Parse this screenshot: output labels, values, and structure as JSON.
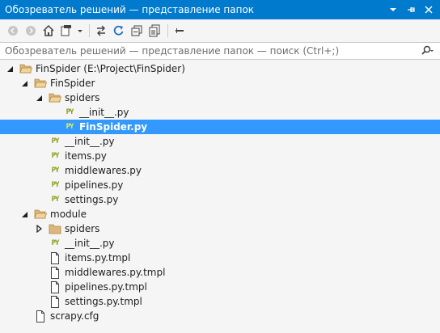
{
  "title": "Обозреватель решений — представление папок",
  "search": {
    "placeholder": "Обозреватель решений — представление папок — поиск (Ctrl+;)"
  },
  "colors": {
    "accent": "#007acc",
    "selection": "#3399ff",
    "python_badge": "#8a9a1b",
    "folder": "#dcb67a"
  },
  "tree": [
    {
      "label": "FinSpider (E:\\Project\\FinSpider)",
      "icon": "solution-folder-icon",
      "expander": "expanded"
    },
    {
      "label": "FinSpider",
      "icon": "folder-open-icon",
      "expander": "expanded"
    },
    {
      "label": "spiders",
      "icon": "folder-open-icon",
      "expander": "expanded"
    },
    {
      "label": "__init__.py",
      "icon": "python-file-icon",
      "badge": "PY",
      "expander": "none"
    },
    {
      "label": "FinSpider.py",
      "icon": "python-file-icon",
      "badge": "PY",
      "expander": "none",
      "selected": true
    },
    {
      "label": "__init__.py",
      "icon": "python-file-icon",
      "badge": "PY",
      "expander": "none"
    },
    {
      "label": "items.py",
      "icon": "python-file-icon",
      "badge": "PY",
      "expander": "none"
    },
    {
      "label": "middlewares.py",
      "icon": "python-file-icon",
      "badge": "PY",
      "expander": "none"
    },
    {
      "label": "pipelines.py",
      "icon": "python-file-icon",
      "badge": "PY",
      "expander": "none"
    },
    {
      "label": "settings.py",
      "icon": "python-file-icon",
      "badge": "PY",
      "expander": "none"
    },
    {
      "label": "module",
      "icon": "folder-open-icon",
      "expander": "expanded"
    },
    {
      "label": "spiders",
      "icon": "folder-icon",
      "expander": "collapsed"
    },
    {
      "label": "__init__.py",
      "icon": "python-file-icon",
      "badge": "PY",
      "expander": "none"
    },
    {
      "label": "items.py.tmpl",
      "icon": "file-icon",
      "expander": "none"
    },
    {
      "label": "middlewares.py.tmpl",
      "icon": "file-icon",
      "expander": "none"
    },
    {
      "label": "pipelines.py.tmpl",
      "icon": "file-icon",
      "expander": "none"
    },
    {
      "label": "settings.py.tmpl",
      "icon": "file-icon",
      "expander": "none"
    },
    {
      "label": "scrapy.cfg",
      "icon": "file-icon",
      "expander": "none"
    }
  ]
}
